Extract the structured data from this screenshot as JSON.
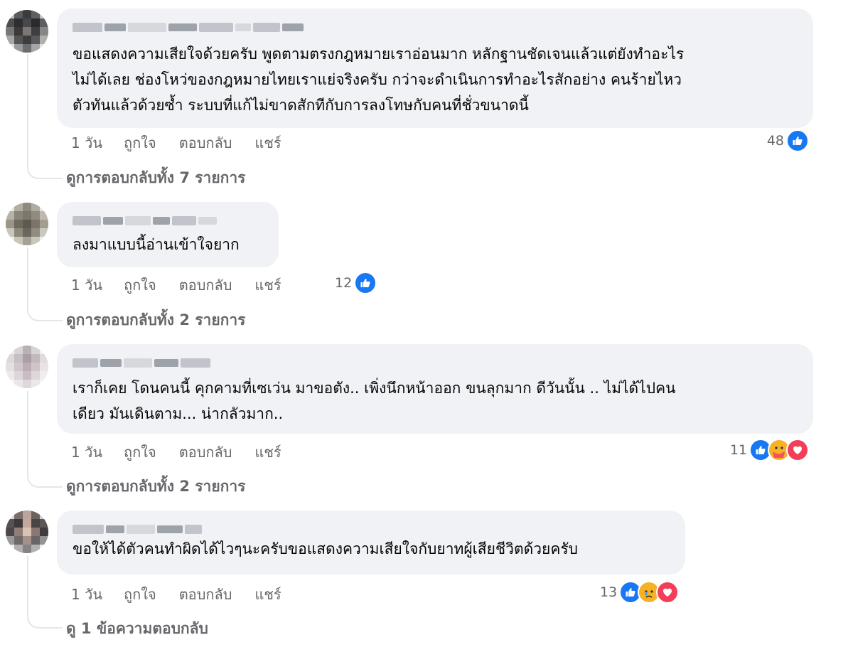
{
  "comments": [
    {
      "text": "ขอแสดงความเสียใจด้วยครับ พูดตามตรงกฎหมายเราอ่อนมาก หลักฐานชัดเจนแล้วแต่ยังทำอะไร\nไม่ได้เลย ช่องโหว่ของกฎหมายไทยเราแย่จริงครับ กว่าจะดำเนินการทำอะไรสักอย่าง คนร้ายไหว\nตัวทันแล้วด้วยซ้ำ ระบบที่แก้ไม่ขาดสักทีกับการลงโทษกับคนที่ชั่วขนาดนี้",
      "time": "1 วัน",
      "like": "ถูกใจ",
      "reply": "ตอบกลับ",
      "share": "แชร์",
      "reaction_count": "48",
      "reactions": [
        "like-icon"
      ],
      "view_replies": "ดูการตอบกลับทั้ง 7 รายการ"
    },
    {
      "text": "ลงมาแบบนี้อ่านเข้าใจยาก",
      "time": "1 วัน",
      "like": "ถูกใจ",
      "reply": "ตอบกลับ",
      "share": "แชร์",
      "reaction_count": "12",
      "reactions": [
        "like-icon"
      ],
      "view_replies": "ดูการตอบกลับทั้ง 2 รายการ"
    },
    {
      "text": "เราก็เคย โดนคนนี้ คุกคามที่เซเว่น มาขอตัง.. เพิ่งนึกหน้าออก ขนลุกมาก ดีวันนั้น .. ไม่ได้ไปคน\nเดียว มันเดินตาม... น่ากลัวมาก..",
      "time": "1 วัน",
      "like": "ถูกใจ",
      "reply": "ตอบกลับ",
      "share": "แชร์",
      "reaction_count": "11",
      "reactions": [
        "like-icon",
        "care-icon",
        "love-icon"
      ],
      "view_replies": "ดูการตอบกลับทั้ง 2 รายการ"
    },
    {
      "text": "ขอให้ได้ตัวคนทำผิดได้ไวๆนะครับขอแสดงความเสียใจกับยาทผู้เสียชีวิตด้วยครับ",
      "time": "1 วัน",
      "like": "ถูกใจ",
      "reply": "ตอบกลับ",
      "share": "แชร์",
      "reaction_count": "13",
      "reactions": [
        "like-icon",
        "sad-icon",
        "love-icon"
      ],
      "view_replies": "ดู 1 ข้อความตอบกลับ"
    }
  ],
  "colors": {
    "bubble": "#f0f2f5",
    "secondary_text": "#65676b",
    "like_blue": "#1877f2",
    "love_red": "#f33e58",
    "care_yellow": "#f7b125"
  }
}
